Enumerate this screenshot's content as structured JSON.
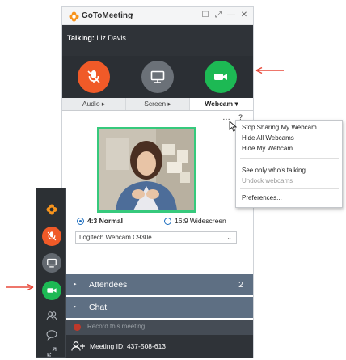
{
  "app": {
    "title": "GoToMeeting",
    "title_caret": "▾"
  },
  "window_controls": [
    "☐",
    "⤢",
    "—",
    "✕"
  ],
  "talking": {
    "prefix": "Talking:",
    "name": "Liz Davis"
  },
  "controls": [
    {
      "name": "audio",
      "icon": "microphone-muted-icon",
      "color": "#f05a28"
    },
    {
      "name": "screen",
      "icon": "monitor-icon",
      "color": "#6b7178"
    },
    {
      "name": "webcam",
      "icon": "video-camera-icon",
      "color": "#1db954"
    }
  ],
  "tabs": [
    {
      "label": "Audio ▸",
      "active": false
    },
    {
      "label": "Screen ▸",
      "active": false
    },
    {
      "label": "Webcam ▾",
      "active": true
    }
  ],
  "webcam": {
    "options_icon": "…",
    "help_icon": "?",
    "frame_color": "#36c97c",
    "ratio_options": [
      {
        "label": "4:3 Normal",
        "selected": true
      },
      {
        "label": "16:9 Widescreen",
        "selected": false
      }
    ],
    "device": "Logitech Webcam C930e",
    "device_caret": "⌄"
  },
  "menu": {
    "items": [
      {
        "label": "Stop Sharing My Webcam",
        "enabled": true
      },
      {
        "label": "Hide All Webcams",
        "enabled": true
      },
      {
        "label": "Hide My Webcam",
        "enabled": true
      },
      {
        "label": "See only who's talking",
        "enabled": true
      },
      {
        "label": "Undock webcams",
        "enabled": false
      },
      {
        "label": "Preferences...",
        "enabled": true
      }
    ]
  },
  "sections": {
    "attendees": {
      "label": "Attendees",
      "count": "2",
      "arrow": "▸"
    },
    "chat": {
      "label": "Chat",
      "arrow": "▸"
    }
  },
  "record": {
    "label": "Record this meeting"
  },
  "meeting": {
    "label": "Meeting ID: 437-508-613"
  },
  "colors": {
    "accent_orange": "#f05a28",
    "accent_green": "#1db954",
    "arrow_red": "#e8493a",
    "section_bg": "#5e6f83"
  }
}
